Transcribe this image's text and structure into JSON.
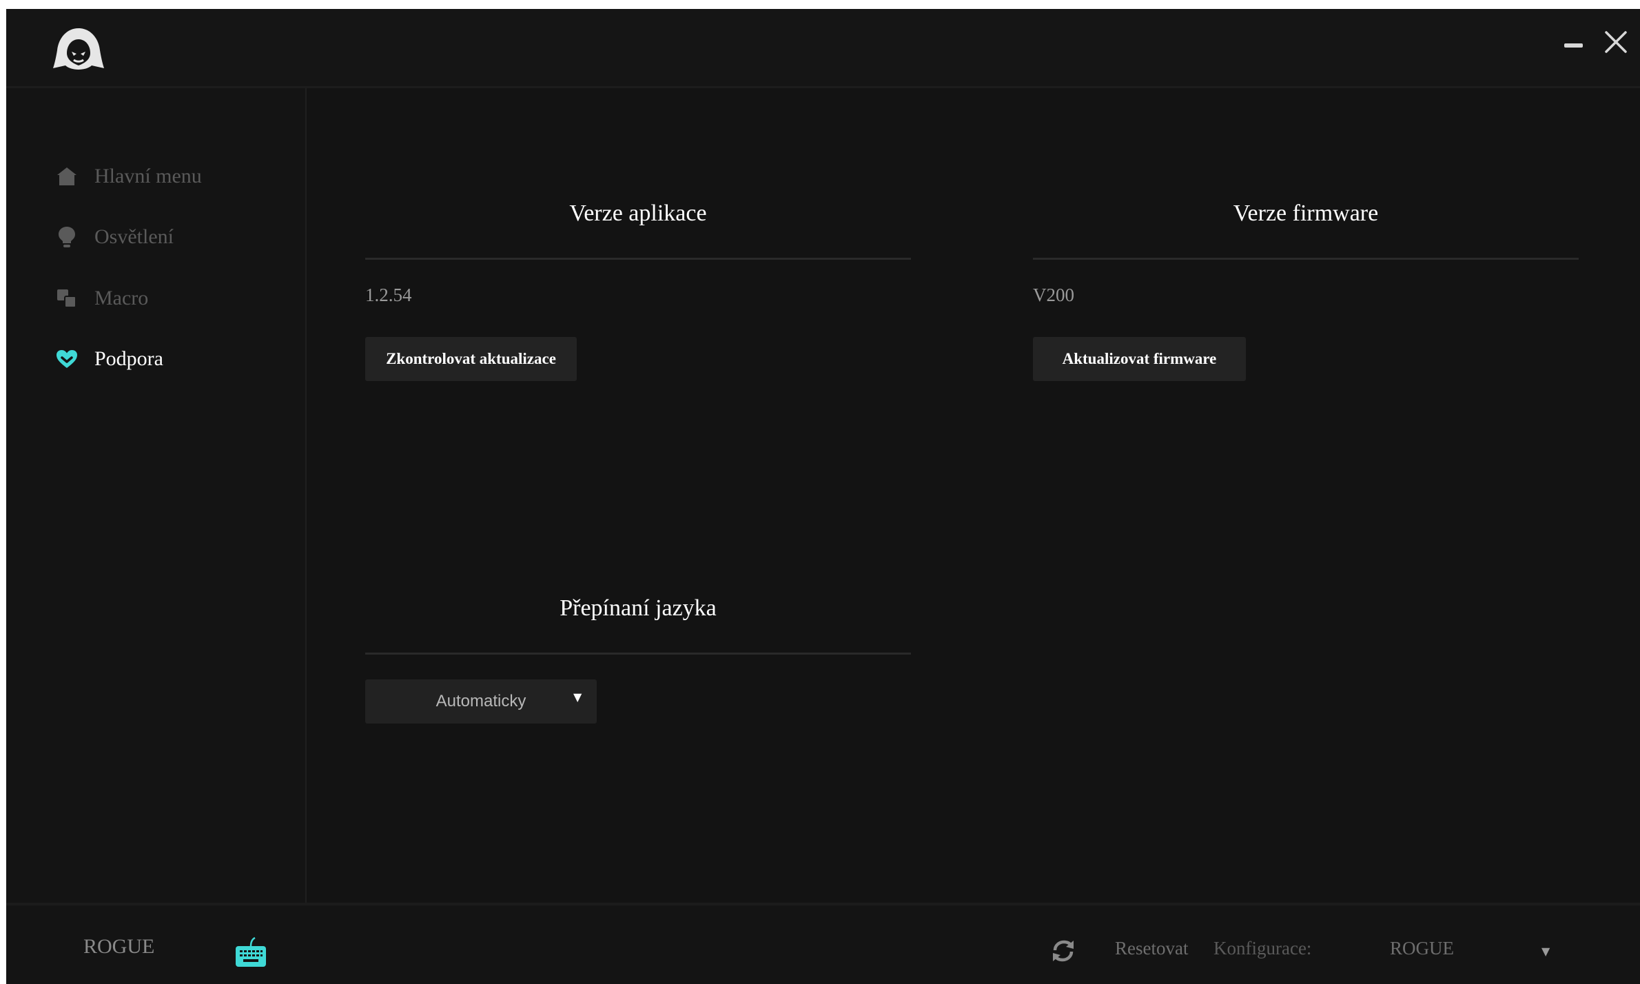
{
  "window": {
    "logo_icon": "hooded-figure-logo-icon",
    "minimize_icon": "minimize-icon",
    "close_icon": "close-icon"
  },
  "sidebar": {
    "items": [
      {
        "label": "Hlavní menu",
        "icon": "home-icon",
        "active": false
      },
      {
        "label": "Osvětlení",
        "icon": "lightbulb-icon",
        "active": false
      },
      {
        "label": "Macro",
        "icon": "macro-icon",
        "active": false
      },
      {
        "label": "Podpora",
        "icon": "heart-icon",
        "active": true
      }
    ]
  },
  "app_version": {
    "title": "Verze aplikace",
    "value": "1.2.54",
    "button": "Zkontrolovat aktualizace"
  },
  "firmware_version": {
    "title": "Verze firmware",
    "value": "V200",
    "button": "Aktualizovat firmware"
  },
  "language": {
    "title": "Přepínaní jazyka",
    "selected": "Automaticky"
  },
  "footer": {
    "device_name": "ROGUE",
    "reset_label": "Resetovat",
    "config_label": "Konfigurace:",
    "config_value": "ROGUE"
  },
  "colors": {
    "accent": "#3fd9d6",
    "background": "#131313",
    "button": "#232323"
  }
}
